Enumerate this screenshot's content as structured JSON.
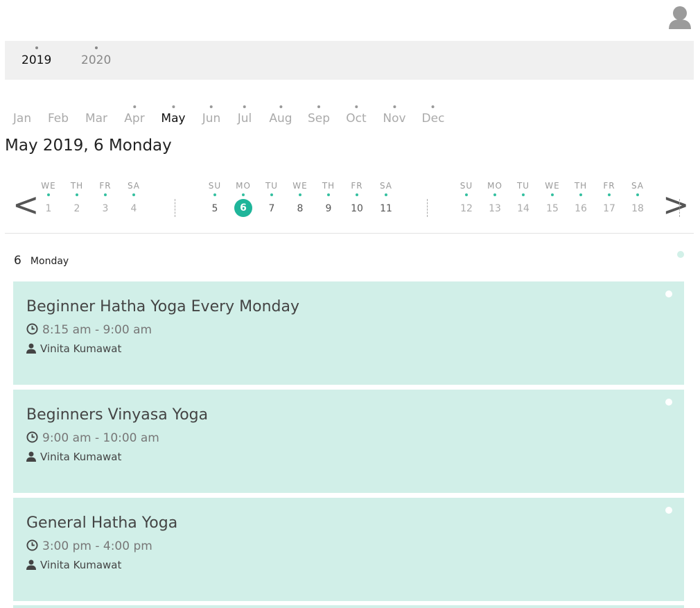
{
  "user": {
    "icon": "user-avatar-icon"
  },
  "years": [
    {
      "label": "2019",
      "active": true
    },
    {
      "label": "2020",
      "active": false
    }
  ],
  "months": [
    {
      "label": "Jan",
      "has_events": false,
      "active": false
    },
    {
      "label": "Feb",
      "has_events": false,
      "active": false
    },
    {
      "label": "Mar",
      "has_events": false,
      "active": false
    },
    {
      "label": "Apr",
      "has_events": true,
      "active": false
    },
    {
      "label": "May",
      "has_events": true,
      "active": true
    },
    {
      "label": "Jun",
      "has_events": true,
      "active": false
    },
    {
      "label": "Jul",
      "has_events": true,
      "active": false
    },
    {
      "label": "Aug",
      "has_events": true,
      "active": false
    },
    {
      "label": "Sep",
      "has_events": true,
      "active": false
    },
    {
      "label": "Oct",
      "has_events": true,
      "active": false
    },
    {
      "label": "Nov",
      "has_events": true,
      "active": false
    },
    {
      "label": "Dec",
      "has_events": true,
      "active": false
    }
  ],
  "date_title": "May 2019, 6 Monday",
  "nav": {
    "prev": "<",
    "next": ">"
  },
  "weeks": [
    {
      "days": [
        {
          "name": "WE",
          "num": "1"
        },
        {
          "name": "TH",
          "num": "2"
        },
        {
          "name": "FR",
          "num": "3"
        },
        {
          "name": "SA",
          "num": "4"
        }
      ]
    },
    {
      "current": true,
      "days": [
        {
          "name": "SU",
          "num": "5"
        },
        {
          "name": "MO",
          "num": "6",
          "selected": true
        },
        {
          "name": "TU",
          "num": "7"
        },
        {
          "name": "WE",
          "num": "8"
        },
        {
          "name": "TH",
          "num": "9"
        },
        {
          "name": "FR",
          "num": "10"
        },
        {
          "name": "SA",
          "num": "11"
        }
      ]
    },
    {
      "days": [
        {
          "name": "SU",
          "num": "12"
        },
        {
          "name": "MO",
          "num": "13"
        },
        {
          "name": "TU",
          "num": "14"
        },
        {
          "name": "WE",
          "num": "15"
        },
        {
          "name": "TH",
          "num": "16"
        },
        {
          "name": "FR",
          "num": "17"
        },
        {
          "name": "SA",
          "num": "18"
        }
      ]
    }
  ],
  "selected_day": {
    "number": "6",
    "weekday": "Monday"
  },
  "events": [
    {
      "title": "Beginner Hatha Yoga Every Monday",
      "time": "8:15 am - 9:00 am",
      "instructor": "Vinita Kumawat"
    },
    {
      "title": "Beginners Vinyasa Yoga",
      "time": "9:00 am - 10:00 am",
      "instructor": "Vinita Kumawat"
    },
    {
      "title": "General Hatha Yoga",
      "time": "3:00 pm - 4:00 pm",
      "instructor": "Vinita Kumawat"
    }
  ],
  "colors": {
    "accent": "#1fb59a",
    "event_bg": "#d1efe8",
    "dot": "#34c0a0"
  }
}
